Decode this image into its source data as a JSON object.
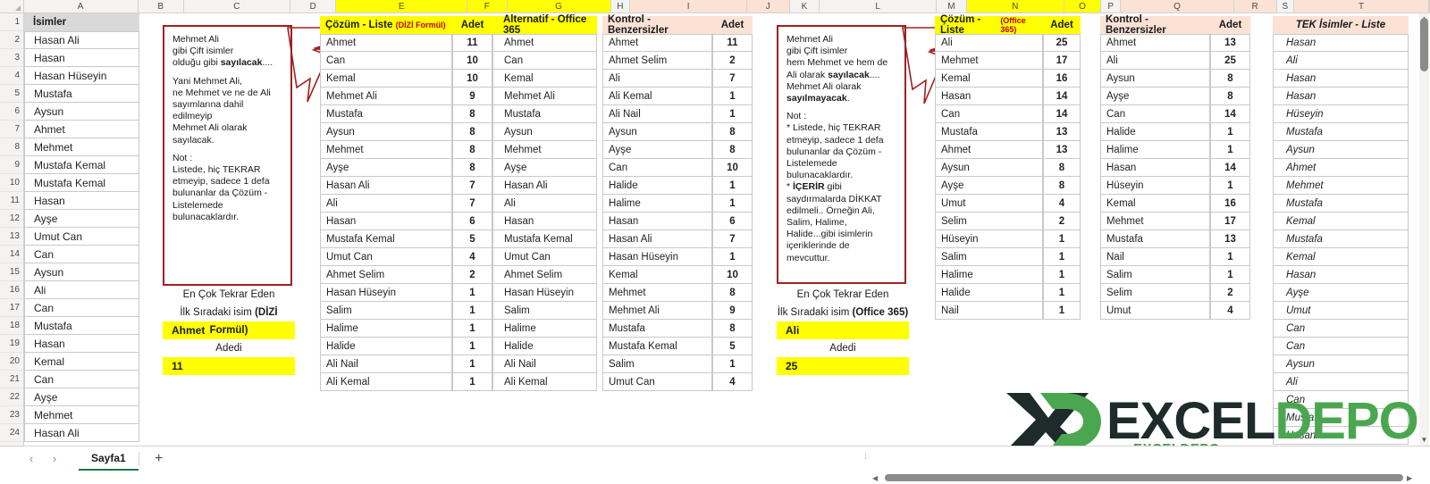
{
  "app": {
    "sheet_tab": "Sayfa1",
    "add_sheet_label": "+",
    "nav_prev": "‹",
    "nav_next": "›"
  },
  "logo": {
    "mark": "X",
    "word_dark": "EXCEL",
    "word_green": "DEPO",
    "sub": "EXCELDEPO"
  },
  "column_headers": [
    "A",
    "B",
    "C",
    "D",
    "E",
    "F",
    "G",
    "H",
    "I",
    "J",
    "K",
    "L",
    "M",
    "N",
    "O",
    "P",
    "Q",
    "R",
    "S",
    "T"
  ],
  "row_headers": [
    "1",
    "2",
    "3",
    "4",
    "5",
    "6",
    "7",
    "8",
    "9",
    "10",
    "11",
    "12",
    "13",
    "14",
    "15",
    "16",
    "17",
    "18",
    "19",
    "20",
    "21",
    "22",
    "23",
    "24"
  ],
  "isimler": {
    "header": "İsimler",
    "values": [
      "Hasan Ali",
      "Hasan",
      "Hasan Hüseyin",
      "Mustafa",
      "Aysun",
      "Ahmet",
      "Mehmet",
      "Mustafa Kemal",
      "Mustafa Kemal",
      "Hasan",
      "Ayşe",
      "Umut Can",
      "Can",
      "Aysun",
      "Ali",
      "Can",
      "Mustafa",
      "Hasan",
      "Kemal",
      "Can",
      "Ayşe",
      "Mehmet",
      "Hasan Ali"
    ]
  },
  "callout1": {
    "lines": [
      "Mehmet Ali",
      "gibi Çift isimler",
      "olduğu gibi sayılacak....",
      "",
      "Yani Mehmet Ali,",
      "ne Mehmet ve ne de Ali",
      "sayımlarına dahil",
      "edilmeyip",
      "Mehmet Ali olarak",
      "sayılacak.",
      "",
      "Not :",
      "Listede, hiç TEKRAR",
      "etmeyip, sadece 1 defa",
      "bulunanlar da Çözüm -",
      "Listelemede",
      "bulunacaklardır."
    ]
  },
  "callout2": {
    "lines": [
      "Mehmet Ali",
      "gibi Çift isimler",
      "hem Mehmet ve hem de",
      "Ali olarak sayılacak....",
      "Mehmet Ali olarak",
      "sayılmayacak.",
      "",
      "Not :",
      "* Listede, hiç TEKRAR",
      "etmeyip, sadece 1 defa",
      "bulunanlar da Çözüm -",
      "Listelemede",
      "bulunacaklardır.",
      "* İÇERİR gibi",
      "saydırmalarda DİKKAT",
      "edilmeli.. Örneğin Ali,",
      "Salim, Halime,",
      "Halide...gibi isimlerin",
      "içeriklerinde de",
      "mevcuttur."
    ]
  },
  "summary1": {
    "line1": "En Çok Tekrar Eden",
    "line2_pre": "İlk Sıradaki isim ",
    "line2_bold": "(DİZİ Formül)",
    "name": "Ahmet",
    "count_label": "Adedi",
    "count": "11"
  },
  "summary2": {
    "line1": "En Çok Tekrar Eden",
    "line2_pre": "İlk Sıradaki isim ",
    "line2_bold": "(Office 365)",
    "name": "Ali",
    "count_label": "Adedi",
    "count": "25"
  },
  "table_cozum_dizi": {
    "header_main": "Çözüm - Liste",
    "header_sub": "(DİZİ Formül)",
    "header_adet": "Adet",
    "header_alt": "Alternatif - Office 365",
    "rows": [
      {
        "name": "Ahmet",
        "adet": "11",
        "alt": "Ahmet"
      },
      {
        "name": "Can",
        "adet": "10",
        "alt": "Can"
      },
      {
        "name": "Kemal",
        "adet": "10",
        "alt": "Kemal"
      },
      {
        "name": "Mehmet Ali",
        "adet": "9",
        "alt": "Mehmet Ali"
      },
      {
        "name": "Mustafa",
        "adet": "8",
        "alt": "Mustafa"
      },
      {
        "name": "Aysun",
        "adet": "8",
        "alt": "Aysun"
      },
      {
        "name": "Mehmet",
        "adet": "8",
        "alt": "Mehmet"
      },
      {
        "name": "Ayşe",
        "adet": "8",
        "alt": "Ayşe"
      },
      {
        "name": "Hasan Ali",
        "adet": "7",
        "alt": "Hasan Ali"
      },
      {
        "name": "Ali",
        "adet": "7",
        "alt": "Ali"
      },
      {
        "name": "Hasan",
        "adet": "6",
        "alt": "Hasan"
      },
      {
        "name": "Mustafa Kemal",
        "adet": "5",
        "alt": "Mustafa Kemal"
      },
      {
        "name": "Umut Can",
        "adet": "4",
        "alt": "Umut Can"
      },
      {
        "name": "Ahmet Selim",
        "adet": "2",
        "alt": "Ahmet Selim"
      },
      {
        "name": "Hasan Hüseyin",
        "adet": "1",
        "alt": "Hasan Hüseyin"
      },
      {
        "name": "Salim",
        "adet": "1",
        "alt": "Salim"
      },
      {
        "name": "Halime",
        "adet": "1",
        "alt": "Halime"
      },
      {
        "name": "Halide",
        "adet": "1",
        "alt": "Halide"
      },
      {
        "name": "Ali Nail",
        "adet": "1",
        "alt": "Ali Nail"
      },
      {
        "name": "Ali Kemal",
        "adet": "1",
        "alt": "Ali Kemal"
      }
    ]
  },
  "table_kontrol_1": {
    "header_main": "Kontrol - Benzersizler",
    "header_adet": "Adet",
    "rows": [
      {
        "name": "Ahmet",
        "adet": "11"
      },
      {
        "name": "Ahmet Selim",
        "adet": "2"
      },
      {
        "name": "Ali",
        "adet": "7"
      },
      {
        "name": "Ali Kemal",
        "adet": "1"
      },
      {
        "name": "Ali Nail",
        "adet": "1"
      },
      {
        "name": "Aysun",
        "adet": "8"
      },
      {
        "name": "Ayşe",
        "adet": "8"
      },
      {
        "name": "Can",
        "adet": "10"
      },
      {
        "name": "Halide",
        "adet": "1"
      },
      {
        "name": "Halime",
        "adet": "1"
      },
      {
        "name": "Hasan",
        "adet": "6"
      },
      {
        "name": "Hasan Ali",
        "adet": "7"
      },
      {
        "name": "Hasan Hüseyin",
        "adet": "1"
      },
      {
        "name": "Kemal",
        "adet": "10"
      },
      {
        "name": "Mehmet",
        "adet": "8"
      },
      {
        "name": "Mehmet Ali",
        "adet": "9"
      },
      {
        "name": "Mustafa",
        "adet": "8"
      },
      {
        "name": "Mustafa Kemal",
        "adet": "5"
      },
      {
        "name": "Salim",
        "adet": "1"
      },
      {
        "name": "Umut Can",
        "adet": "4"
      }
    ]
  },
  "table_cozum_365": {
    "header_main": "Çözüm - Liste",
    "header_sub": "(Office 365)",
    "header_adet": "Adet",
    "rows": [
      {
        "name": "Ali",
        "adet": "25"
      },
      {
        "name": "Mehmet",
        "adet": "17"
      },
      {
        "name": "Kemal",
        "adet": "16"
      },
      {
        "name": "Hasan",
        "adet": "14"
      },
      {
        "name": "Can",
        "adet": "14"
      },
      {
        "name": "Mustafa",
        "adet": "13"
      },
      {
        "name": "Ahmet",
        "adet": "13"
      },
      {
        "name": "Aysun",
        "adet": "8"
      },
      {
        "name": "Ayşe",
        "adet": "8"
      },
      {
        "name": "Umut",
        "adet": "4"
      },
      {
        "name": "Selim",
        "adet": "2"
      },
      {
        "name": "Hüseyin",
        "adet": "1"
      },
      {
        "name": "Salim",
        "adet": "1"
      },
      {
        "name": "Halime",
        "adet": "1"
      },
      {
        "name": "Halide",
        "adet": "1"
      },
      {
        "name": "Nail",
        "adet": "1"
      }
    ]
  },
  "table_kontrol_2": {
    "header_main": "Kontrol - Benzersizler",
    "header_adet": "Adet",
    "rows": [
      {
        "name": "Ahmet",
        "adet": "13"
      },
      {
        "name": "Ali",
        "adet": "25"
      },
      {
        "name": "Aysun",
        "adet": "8"
      },
      {
        "name": "Ayşe",
        "adet": "8"
      },
      {
        "name": "Can",
        "adet": "14"
      },
      {
        "name": "Halide",
        "adet": "1"
      },
      {
        "name": "Halime",
        "adet": "1"
      },
      {
        "name": "Hasan",
        "adet": "14"
      },
      {
        "name": "Hüseyin",
        "adet": "1"
      },
      {
        "name": "Kemal",
        "adet": "16"
      },
      {
        "name": "Mehmet",
        "adet": "17"
      },
      {
        "name": "Mustafa",
        "adet": "13"
      },
      {
        "name": "Nail",
        "adet": "1"
      },
      {
        "name": "Salim",
        "adet": "1"
      },
      {
        "name": "Selim",
        "adet": "2"
      },
      {
        "name": "Umut",
        "adet": "4"
      }
    ]
  },
  "table_tek_isimler": {
    "header": "TEK İsimler - Liste",
    "rows": [
      "Hasan",
      "Ali",
      "Hasan",
      "Hasan",
      "Hüseyin",
      "Mustafa",
      "Aysun",
      "Ahmet",
      "Mehmet",
      "Mustafa",
      "Kemal",
      "Mustafa",
      "Kemal",
      "Hasan",
      "Ayşe",
      "Umut",
      "Can",
      "Can",
      "Aysun",
      "Ali",
      "Can",
      "Mustafa",
      "Hasan"
    ]
  },
  "colors": {
    "header_yellow": "#ffff00",
    "header_peach": "#fbe2d5",
    "callout_border": "#a02020",
    "accent_red": "#c00000",
    "excel_green": "#217346",
    "logo_green": "#4aa74f",
    "logo_dark": "#1d2b2b"
  }
}
